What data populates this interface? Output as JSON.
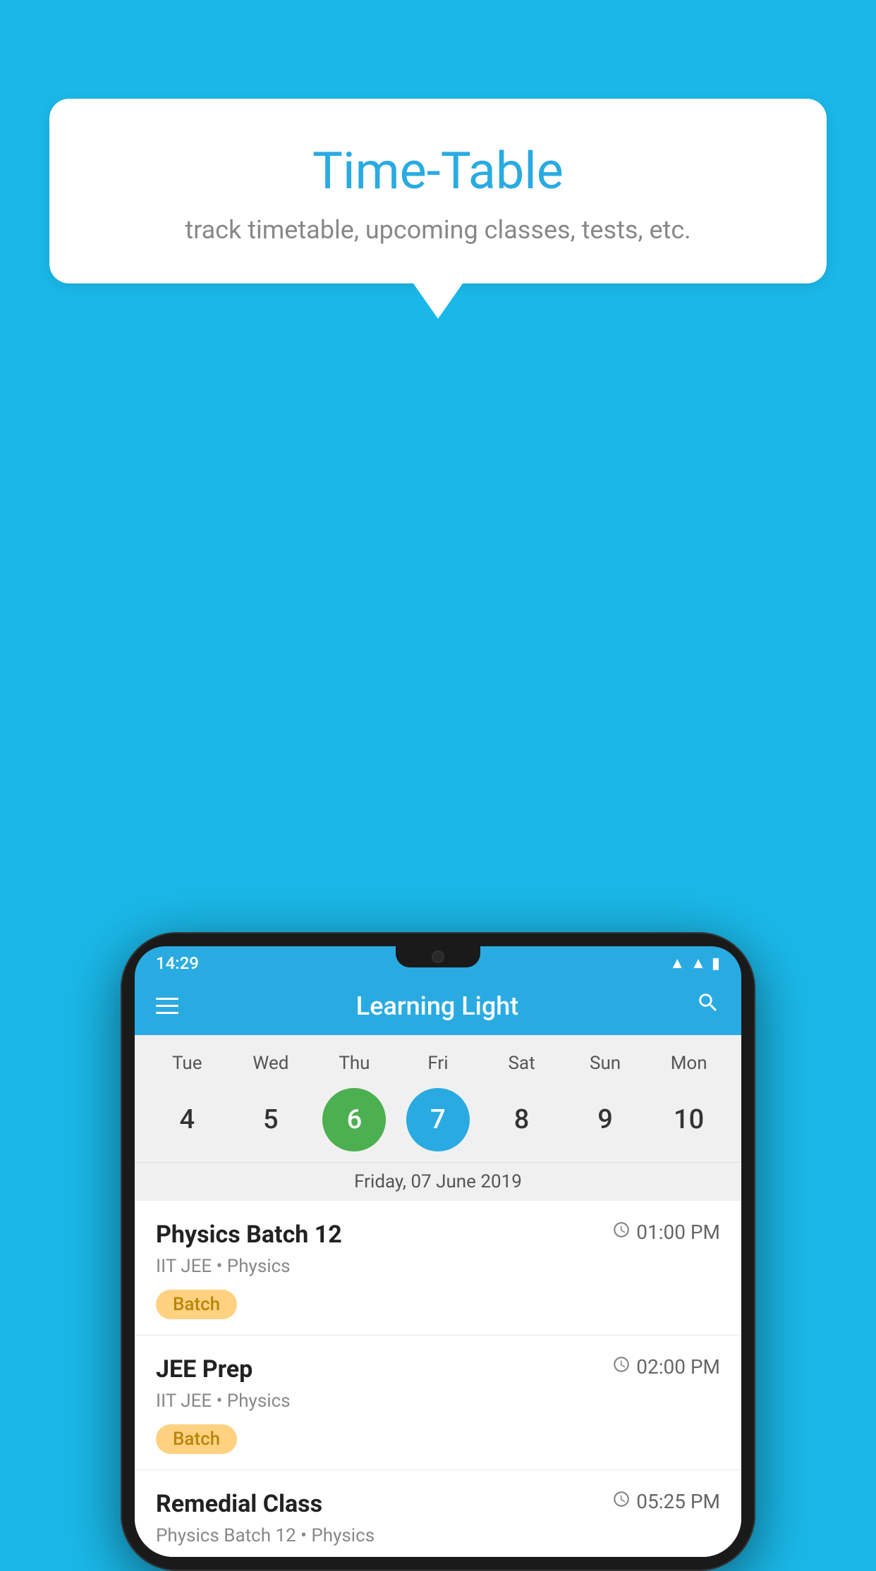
{
  "background_color": "#1ab8e8",
  "speech_bubble": {
    "title": "Time-Table",
    "subtitle": "track timetable, upcoming classes, tests, etc."
  },
  "phone": {
    "status_bar": {
      "time": "14:29"
    },
    "app_bar": {
      "title": "Learning Light",
      "hamburger_label": "menu",
      "search_label": "search"
    },
    "calendar": {
      "days": [
        "Tue",
        "Wed",
        "Thu",
        "Fri",
        "Sat",
        "Sun",
        "Mon"
      ],
      "dates": [
        4,
        5,
        6,
        7,
        8,
        9,
        10
      ],
      "today_index": 2,
      "selected_index": 3,
      "selected_date_label": "Friday, 07 June 2019"
    },
    "schedule_items": [
      {
        "title": "Physics Batch 12",
        "time": "01:00 PM",
        "subtitle": "IIT JEE • Physics",
        "badge": "Batch"
      },
      {
        "title": "JEE Prep",
        "time": "02:00 PM",
        "subtitle": "IIT JEE • Physics",
        "badge": "Batch"
      },
      {
        "title": "Remedial Class",
        "time": "05:25 PM",
        "subtitle": "Physics Batch 12 • Physics",
        "badge": null
      }
    ]
  }
}
